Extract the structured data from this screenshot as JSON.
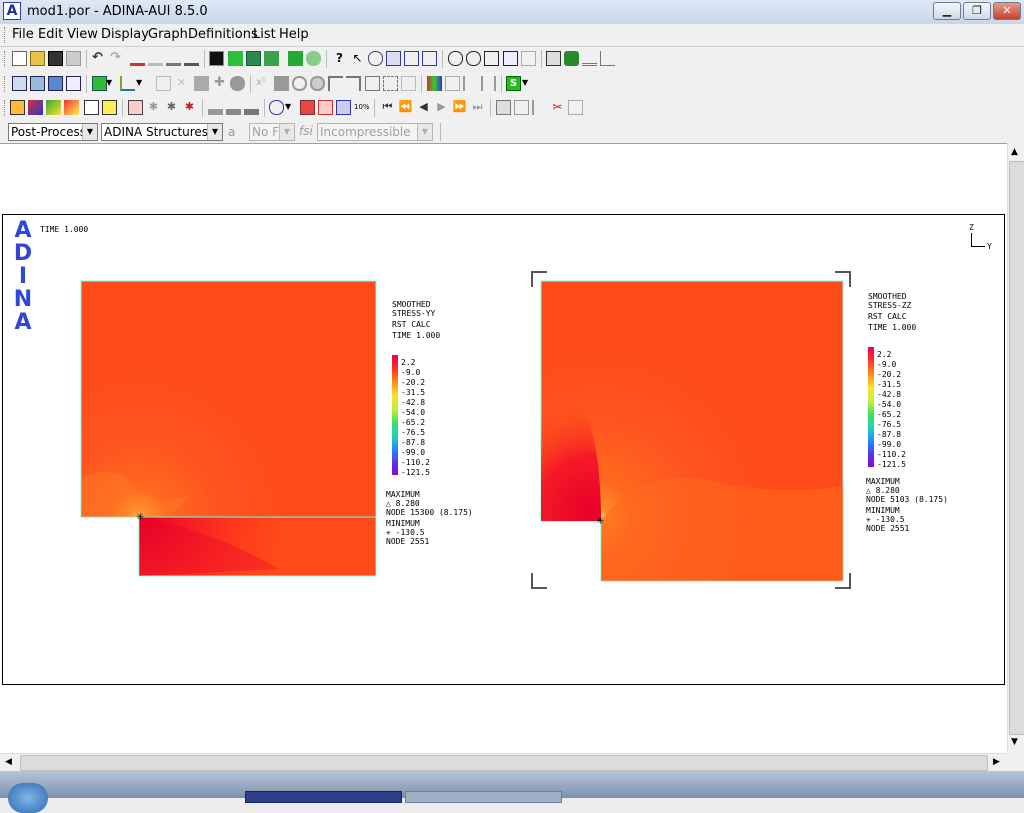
{
  "window": {
    "title": "mod1.por - ADINA-AUI  8.5.0",
    "app_icon_letter": "A",
    "minimize": "▁",
    "maximize": "❐",
    "close": "✕"
  },
  "menu": [
    "File",
    "Edit",
    "View",
    "Display",
    "Graph",
    "Definitions",
    "List",
    "Help"
  ],
  "combos": {
    "mode": "Post-Processing",
    "program": "ADINA Structures",
    "fsi": "No FSI",
    "fsi_icon": "fsi",
    "material": "Incompressible"
  },
  "viewport": {
    "time_label": "TIME 1.000",
    "logo_letters": [
      "A",
      "D",
      "I",
      "N",
      "A"
    ],
    "triad": {
      "z": "Z",
      "y": "Y"
    },
    "plots": [
      {
        "legend_title": [
          "SMOOTHED",
          "STRESS-YY",
          "RST CALC",
          "TIME 1.000"
        ],
        "scale": [
          "2.2",
          "-9.0",
          "-20.2",
          "-31.5",
          "-42.8",
          "-54.0",
          "-65.2",
          "-76.5",
          "-87.8",
          "-99.0",
          "-110.2",
          "-121.5"
        ],
        "maximum_label": "MAXIMUM",
        "maximum_value": "△ 8.280",
        "maximum_node": "NODE 15300 (8.175)",
        "minimum_label": "MINIMUM",
        "minimum_value": "✳ -130.5",
        "minimum_node": "NODE 2551"
      },
      {
        "legend_title": [
          "SMOOTHED",
          "STRESS-ZZ",
          "RST CALC",
          "TIME 1.000"
        ],
        "scale": [
          "2.2",
          "-9.0",
          "-20.2",
          "-31.5",
          "-42.8",
          "-54.0",
          "-65.2",
          "-76.5",
          "-87.8",
          "-99.0",
          "-110.2",
          "-121.5"
        ],
        "maximum_label": "MAXIMUM",
        "maximum_value": "△ 8.280",
        "maximum_node": "NODE 5103 (8.175)",
        "minimum_label": "MINIMUM",
        "minimum_value": "✳ -130.5",
        "minimum_node": "NODE 2551"
      }
    ]
  },
  "colors": {
    "contour_base": "#ff4a1a",
    "contour_hot": "#e8002a",
    "contour_warm": "#ff7a1a",
    "logo": "#2f47d8"
  }
}
